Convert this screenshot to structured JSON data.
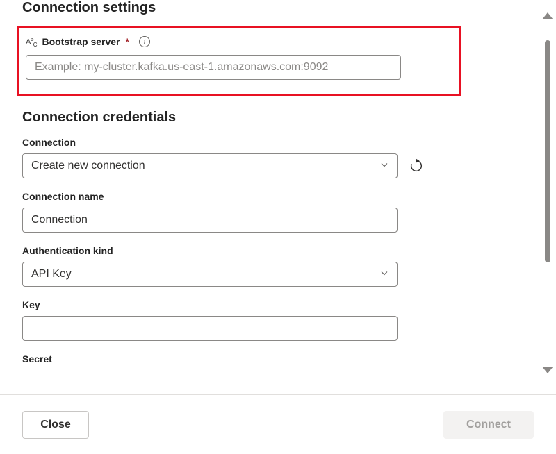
{
  "sections": {
    "connection_settings": "Connection settings",
    "connection_credentials": "Connection credentials"
  },
  "bootstrap": {
    "label": "Bootstrap server",
    "placeholder": "Example: my-cluster.kafka.us-east-1.amazonaws.com:9092",
    "value": ""
  },
  "connection": {
    "label": "Connection",
    "selected": "Create new connection"
  },
  "connection_name": {
    "label": "Connection name",
    "value": "Connection"
  },
  "auth_kind": {
    "label": "Authentication kind",
    "selected": "API Key"
  },
  "key": {
    "label": "Key",
    "value": ""
  },
  "secret": {
    "label": "Secret"
  },
  "footer": {
    "close": "Close",
    "connect": "Connect"
  }
}
